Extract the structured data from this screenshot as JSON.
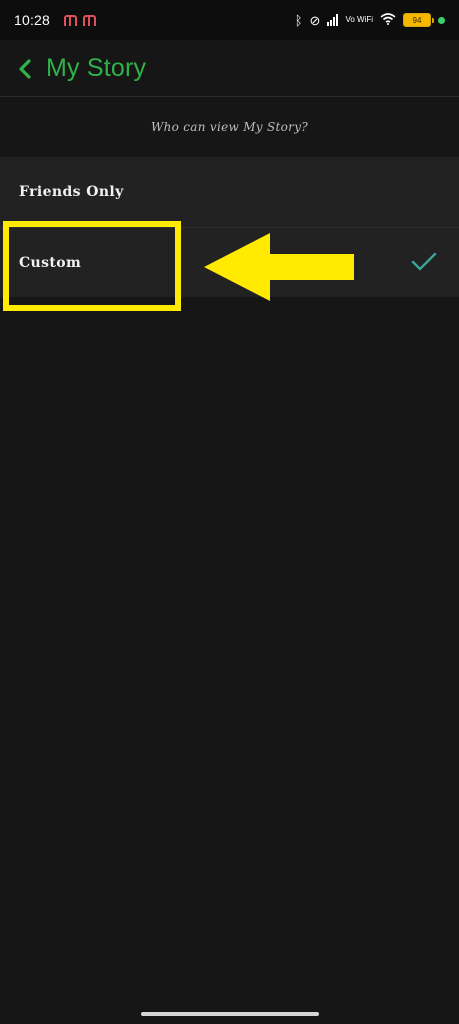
{
  "status_bar": {
    "time": "10:28",
    "network_label": "Vo WiFi",
    "battery_level": "94"
  },
  "header": {
    "title": "My Story",
    "accent_color": "#2fb349"
  },
  "section": {
    "label": "Who can view My Story?"
  },
  "options": [
    {
      "label": "Friends Only",
      "selected": false
    },
    {
      "label": "Custom",
      "selected": true
    }
  ],
  "annotation": {
    "highlight_color": "#ffea00",
    "target": "Custom"
  },
  "icons": {
    "back": "chevron-left-icon",
    "check": "check-icon",
    "annotation_arrow": "arrow-left-icon"
  },
  "colors": {
    "background": "#161616",
    "row_background": "#222222",
    "check": "#3aa39a"
  }
}
